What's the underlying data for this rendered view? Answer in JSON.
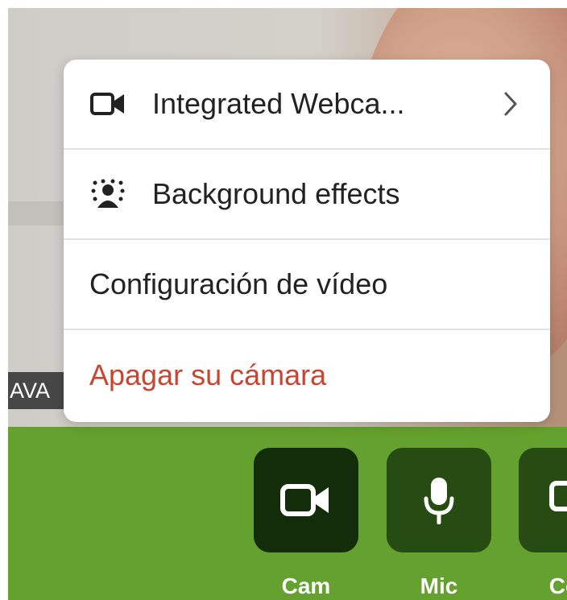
{
  "video": {
    "participant_name": "AVA"
  },
  "menu": {
    "items": [
      {
        "label": "Integrated Webca...",
        "icon": "video-camera-icon",
        "has_submenu": true
      },
      {
        "label": "Background effects",
        "icon": "background-effects-icon",
        "has_submenu": false
      },
      {
        "label": "Configuración de vídeo",
        "icon": "",
        "has_submenu": false
      },
      {
        "label": "Apagar su cámara",
        "icon": "",
        "has_submenu": false,
        "style": "danger"
      }
    ]
  },
  "toolbar": {
    "cam_label": "Cam",
    "mic_label": "Mic",
    "con_label": "Con"
  },
  "colors": {
    "toolbar_bg": "#65a12e",
    "button_bg": "#264c13",
    "button_active_bg": "#132d0a",
    "danger_text": "#c8452f"
  }
}
